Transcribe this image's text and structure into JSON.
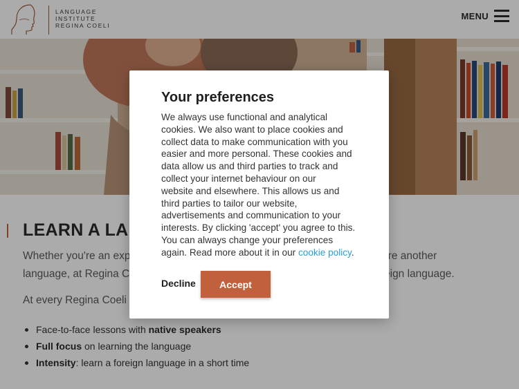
{
  "colors": {
    "accent": "#c0603c",
    "link": "#2a9fd6",
    "overlay": "rgba(0,0,0,0.33)"
  },
  "header": {
    "logo_lines": [
      "LANGUAGE",
      "INSTITUTE",
      "REGINA COELI"
    ],
    "menu_label": "MENU",
    "menu_icon": "hamburger-menu-icon"
  },
  "main": {
    "heading": "LEARN A LAN",
    "intro_parts": {
      "line1_left": "Whether you're an exp",
      "line1_right": "quire another",
      "line2_left": "language, at Regina Co",
      "line2_right": "eign language."
    },
    "sub_text": "At every Regina Coeli t",
    "bullets": [
      {
        "pre": "Face-to-face lessons with ",
        "bold": "native speakers",
        "post": ""
      },
      {
        "pre": "",
        "bold": "Full focus",
        "post": " on learning the language"
      },
      {
        "pre": "",
        "bold": "Intensity",
        "post": ": learn a foreign language in a short time"
      }
    ]
  },
  "cookie_modal": {
    "title": "Your preferences",
    "body_lines": [
      "We always use functional and analytical",
      "cookies. We also want to place cookies and",
      "collect data to make communication with you",
      "easier and more personal. These cookies and",
      "data allow us and third parties to track and",
      "collect your internet behaviour on our",
      "website and elsewhere. This allows us and",
      "third parties to tailor our website,",
      "advertisements and communication to your",
      "interests. By clicking 'accept' you agree to this.",
      "You can always change your preferences"
    ],
    "body_last_prefix": "again. Read more about it in our ",
    "link_text": "cookie policy",
    "body_last_suffix": ".",
    "decline_label": "Decline",
    "accept_label": "Accept"
  }
}
